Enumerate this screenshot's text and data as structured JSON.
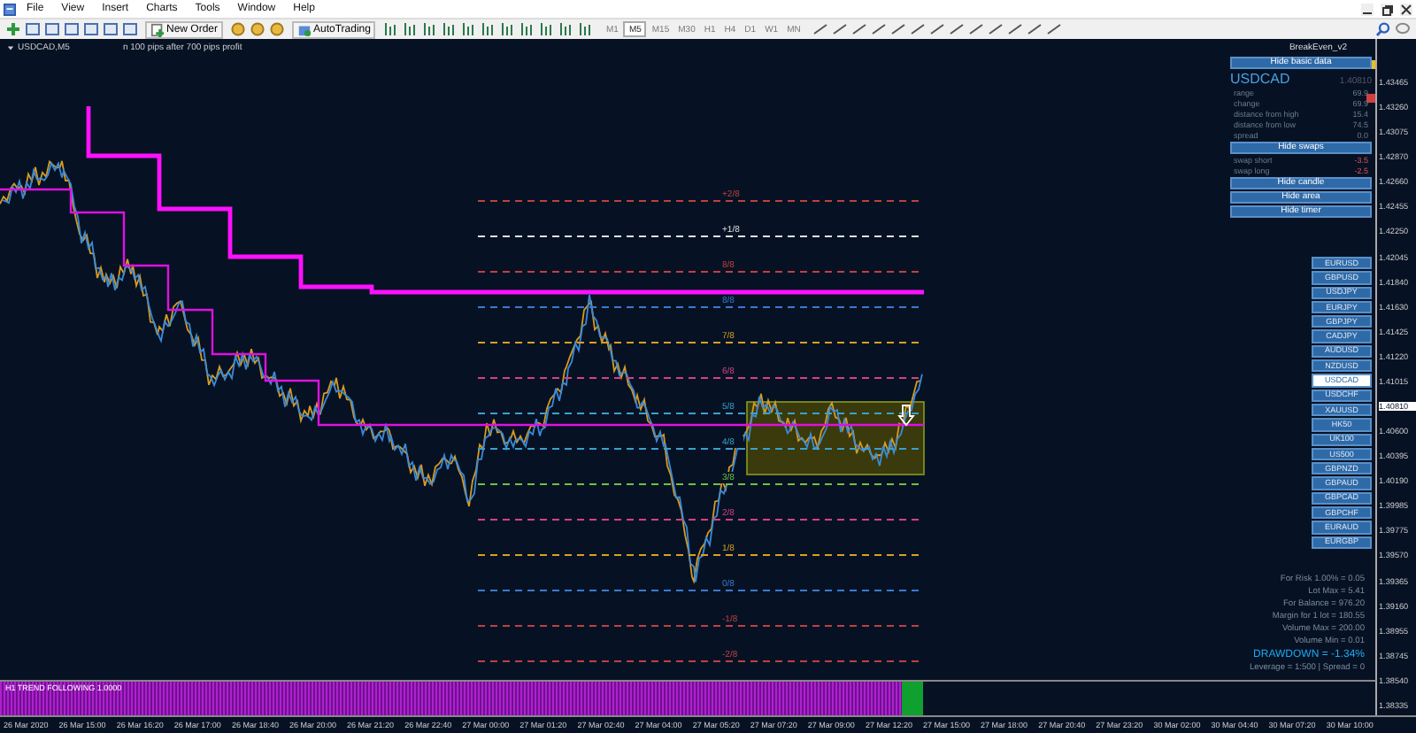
{
  "menu": [
    "File",
    "View",
    "Insert",
    "Charts",
    "Tools",
    "Window",
    "Help"
  ],
  "toolbar": {
    "new_order": "New Order",
    "auto_trading": "AutoTrading",
    "timeframes": [
      {
        "label": "M1",
        "selected": false
      },
      {
        "label": "M5",
        "selected": true
      },
      {
        "label": "M15",
        "selected": false
      },
      {
        "label": "M30",
        "selected": false
      },
      {
        "label": "H1",
        "selected": false
      },
      {
        "label": "H4",
        "selected": false
      },
      {
        "label": "D1",
        "selected": false
      },
      {
        "label": "W1",
        "selected": false
      },
      {
        "label": "MN",
        "selected": false
      }
    ]
  },
  "chart": {
    "title": "USDCAD,M5",
    "comment": "n 100 pips after 700 pips profit",
    "indicator_name": "BreakEven_v2",
    "levels": [
      {
        "label": "+2/8",
        "color": "#c04040"
      },
      {
        "label": "+1/8",
        "color": "#e0e0e0"
      },
      {
        "label": "8/8",
        "color": "#c04040"
      },
      {
        "label": "8/8",
        "color": "#3a7ad0"
      },
      {
        "label": "7/8",
        "color": "#d8a020"
      },
      {
        "label": "6/8",
        "color": "#d84080"
      },
      {
        "label": "5/8",
        "color": "#3aa0d0"
      },
      {
        "label": "4/8",
        "color": "#3aa0d0"
      },
      {
        "label": "3/8",
        "color": "#70c040"
      },
      {
        "label": "2/8",
        "color": "#d84080"
      },
      {
        "label": "1/8",
        "color": "#d8a020"
      },
      {
        "label": "0/8",
        "color": "#3a7ad0"
      },
      {
        "label": "-1/8",
        "color": "#c04040"
      },
      {
        "label": "-2/8",
        "color": "#c04040"
      }
    ],
    "price_axis": [
      {
        "label": "1.43465",
        "current": false
      },
      {
        "label": "1.43260",
        "current": false
      },
      {
        "label": "1.43075",
        "current": false
      },
      {
        "label": "1.42870",
        "current": false
      },
      {
        "label": "1.42660",
        "current": false
      },
      {
        "label": "1.42455",
        "current": false
      },
      {
        "label": "1.42250",
        "current": false
      },
      {
        "label": "1.42045",
        "current": false
      },
      {
        "label": "1.41840",
        "current": false
      },
      {
        "label": "1.41630",
        "current": false
      },
      {
        "label": "1.41425",
        "current": false
      },
      {
        "label": "1.41220",
        "current": false
      },
      {
        "label": "1.41015",
        "current": false
      },
      {
        "label": "1.40810",
        "current": true
      },
      {
        "label": "1.40600",
        "current": false
      },
      {
        "label": "1.40395",
        "current": false
      },
      {
        "label": "1.40190",
        "current": false
      },
      {
        "label": "1.39985",
        "current": false
      },
      {
        "label": "1.39775",
        "current": false
      },
      {
        "label": "1.39570",
        "current": false
      },
      {
        "label": "1.39365",
        "current": false
      },
      {
        "label": "1.39160",
        "current": false
      },
      {
        "label": "1.38955",
        "current": false
      },
      {
        "label": "1.38745",
        "current": false
      },
      {
        "label": "1.38540",
        "current": false
      },
      {
        "label": "1.38335",
        "current": false
      }
    ],
    "time_axis": [
      "26 Mar 2020",
      "26 Mar 15:00",
      "26 Mar 16:20",
      "26 Mar 17:00",
      "26 Mar 18:40",
      "26 Mar 20:00",
      "26 Mar 21:20",
      "26 Mar 22:40",
      "27 Mar 00:00",
      "27 Mar 01:20",
      "27 Mar 02:40",
      "27 Mar 04:00",
      "27 Mar 05:20",
      "27 Mar 07:20",
      "27 Mar 09:00",
      "27 Mar 12:20",
      "27 Mar 15:00",
      "27 Mar 18:00",
      "27 Mar 20:40",
      "27 Mar 23:20",
      "30 Mar 02:00",
      "30 Mar 04:40",
      "30 Mar 07:20",
      "30 Mar 10:00"
    ],
    "oscillator": {
      "label": "H1 TREND FOLLOWING 1.0000"
    }
  },
  "panel": {
    "basic_button": "Hide basic data",
    "symbol": "USDCAD",
    "price": "1.40810",
    "basic_rows": [
      {
        "label": "range",
        "value": "69.9"
      },
      {
        "label": "change",
        "value": "69.9"
      },
      {
        "label": "distance from high",
        "value": "15.4"
      },
      {
        "label": "distance from low",
        "value": "74.5"
      },
      {
        "label": "spread",
        "value": "0.0"
      }
    ],
    "swaps_button": "Hide swaps",
    "swap_rows": [
      {
        "label": "swap short",
        "value": "-3.5"
      },
      {
        "label": "swap long",
        "value": "-2.5"
      }
    ],
    "buttons": [
      "Hide candle",
      "Hide area",
      "Hide timer"
    ],
    "symbols": [
      {
        "label": "EURUSD",
        "selected": false
      },
      {
        "label": "GBPUSD",
        "selected": false
      },
      {
        "label": "USDJPY",
        "selected": false
      },
      {
        "label": "EURJPY",
        "selected": false
      },
      {
        "label": "GBPJPY",
        "selected": false
      },
      {
        "label": "CADJPY",
        "selected": false
      },
      {
        "label": "AUDUSD",
        "selected": false
      },
      {
        "label": "NZDUSD",
        "selected": false
      },
      {
        "label": "USDCAD",
        "selected": true
      },
      {
        "label": "USDCHF",
        "selected": false
      },
      {
        "label": "XAUUSD",
        "selected": false
      },
      {
        "label": "HK50",
        "selected": false
      },
      {
        "label": "UK100",
        "selected": false
      },
      {
        "label": "US500",
        "selected": false
      },
      {
        "label": "GBPNZD",
        "selected": false
      },
      {
        "label": "GBPAUD",
        "selected": false
      },
      {
        "label": "GBPCAD",
        "selected": false
      },
      {
        "label": "GBPCHF",
        "selected": false
      },
      {
        "label": "EURAUD",
        "selected": false
      },
      {
        "label": "EURGBP",
        "selected": false
      }
    ],
    "stats": [
      {
        "text": "For Risk 1.00% = 0.05",
        "kind": "normal"
      },
      {
        "text": "Lot Max = 5.41",
        "kind": "normal"
      },
      {
        "text": "For Balance = 976.20",
        "kind": "normal"
      },
      {
        "text": "Margin for 1 lot = 180.55",
        "kind": "normal"
      },
      {
        "text": "Volume Max = 200.00",
        "kind": "normal"
      },
      {
        "text": "Volume Min = 0.01",
        "kind": "normal"
      },
      {
        "text": "DRAWDOWN = -1.34%",
        "kind": "drawdown"
      },
      {
        "text": "Leverage = 1:500 | Spread = 0",
        "kind": "normal"
      }
    ]
  }
}
